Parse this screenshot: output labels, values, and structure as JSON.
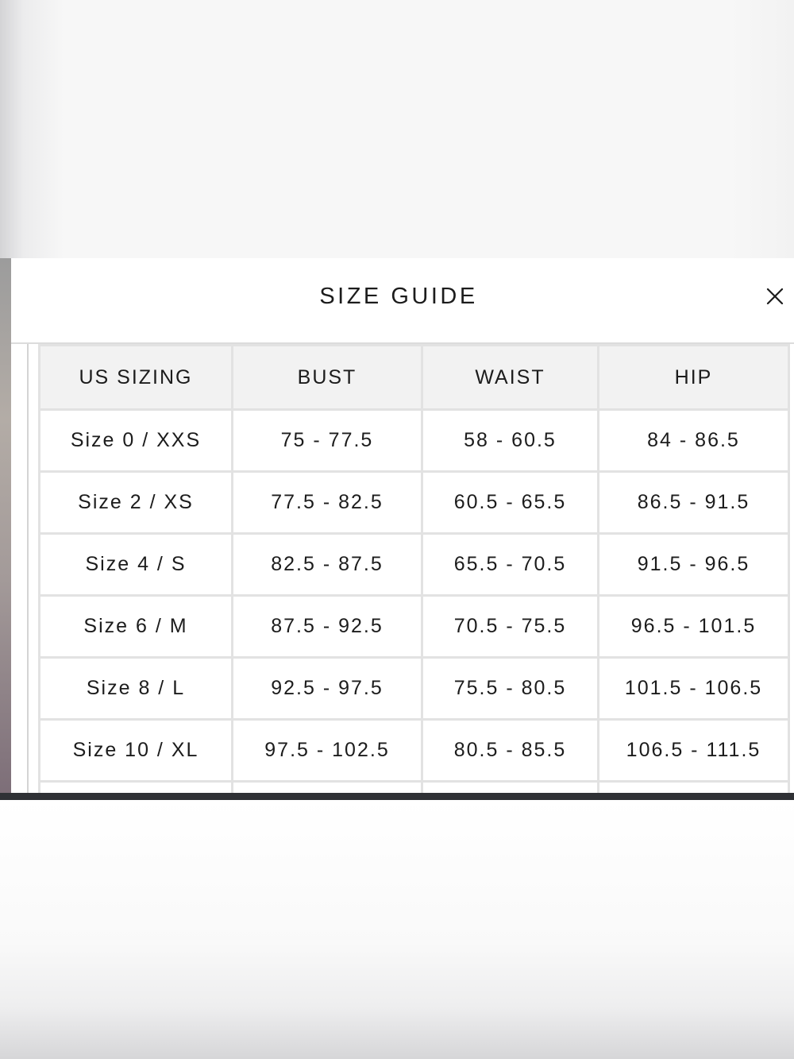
{
  "modal": {
    "title": "SIZE GUIDE",
    "close_icon": "close-icon"
  },
  "table": {
    "headers": [
      "US SIZING",
      "BUST",
      "WAIST",
      "HIP"
    ],
    "rows": [
      [
        "Size 0 / XXS",
        "75 - 77.5",
        "58 - 60.5",
        "84 - 86.5"
      ],
      [
        "Size 2 / XS",
        "77.5 - 82.5",
        "60.5 - 65.5",
        "86.5 - 91.5"
      ],
      [
        "Size 4 / S",
        "82.5 - 87.5",
        "65.5 - 70.5",
        "91.5 - 96.5"
      ],
      [
        "Size 6 / M",
        "87.5 - 92.5",
        "70.5 - 75.5",
        "96.5 - 101.5"
      ],
      [
        "Size 8 / L",
        "92.5 - 97.5",
        "75.5 - 80.5",
        "101.5 - 106.5"
      ],
      [
        "Size 10 / XL",
        "97.5 - 102.5",
        "80.5 - 85.5",
        "106.5 - 111.5"
      ]
    ]
  },
  "colors": {
    "text": "#1c1c1c",
    "header_bg": "#f2f2f2",
    "border": "#e2e2e2",
    "modal_bg": "#ffffff",
    "bottom_bar": "#2f3135"
  }
}
